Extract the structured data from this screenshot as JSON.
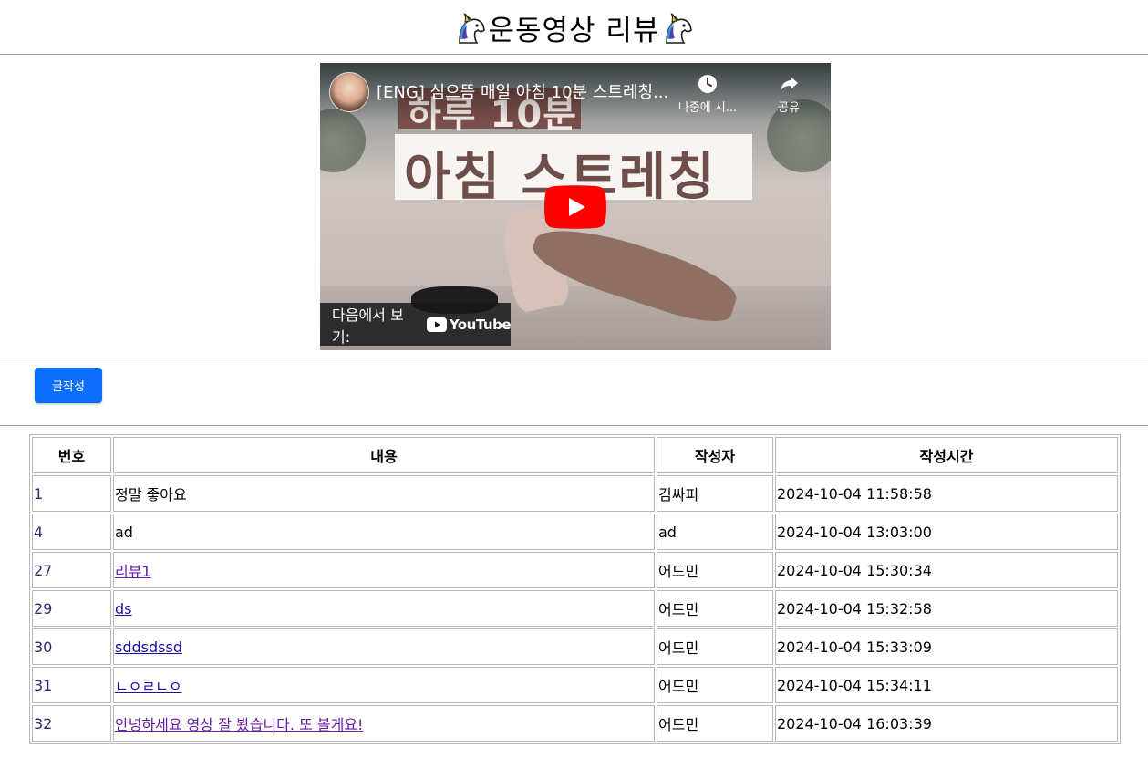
{
  "header": {
    "title": "운동영상 리뷰",
    "left_icon": "unicorn-icon",
    "right_icon": "unicorn-icon"
  },
  "video": {
    "title": "[ENG] 심으뜸 매일 아침 10분 스트레칭...",
    "thumbnail_text_line1": "하루 10분",
    "thumbnail_text_line2": "아침 스트레칭",
    "watch_later_label": "나중에 시...",
    "share_label": "공유",
    "watch_on_label": "다음에서 보기:",
    "youtube_label": "YouTube"
  },
  "toolbar": {
    "write_label": "글작성"
  },
  "table": {
    "headers": [
      "번호",
      "내용",
      "작성자",
      "작성시간"
    ],
    "rows": [
      {
        "num": "1",
        "content": "정말 좋아요",
        "author": "김싸피",
        "time": "2024-10-04 11:58:58",
        "link": false
      },
      {
        "num": "4",
        "content": "ad",
        "author": "ad",
        "time": "2024-10-04 13:03:00",
        "link": false
      },
      {
        "num": "27",
        "content": "리뷰1",
        "author": "어드민",
        "time": "2024-10-04 15:30:34",
        "link": true,
        "visited": true
      },
      {
        "num": "29",
        "content": "ds",
        "author": "어드민",
        "time": "2024-10-04 15:32:58",
        "link": true,
        "visited": false
      },
      {
        "num": "30",
        "content": "sddsdssd",
        "author": "어드민",
        "time": "2024-10-04 15:33:09",
        "link": true,
        "visited": false
      },
      {
        "num": "31",
        "content": "ㄴㅇㄹㄴㅇ",
        "author": "어드민",
        "time": "2024-10-04 15:34:11",
        "link": true,
        "visited": false
      },
      {
        "num": "32",
        "content": "안녕하세요 영상 잘 봤습니다. 또 볼게요!",
        "author": "어드민",
        "time": "2024-10-04 16:03:39",
        "link": true,
        "visited": true
      }
    ]
  },
  "colors": {
    "primary_button": "#0d6efd",
    "link": "#1a0dab",
    "visited_link": "#681da8",
    "youtube_red": "#ff0000"
  }
}
